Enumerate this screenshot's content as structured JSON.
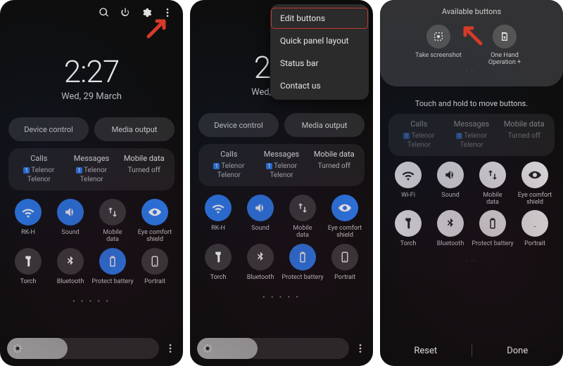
{
  "clock": {
    "time": "2:27",
    "date": "Wed, 29 March"
  },
  "top_icons": [
    "search-icon",
    "power-icon",
    "settings-icon",
    "overflow-icon"
  ],
  "pills": {
    "device_control": "Device control",
    "media_output": "Media output"
  },
  "info_panel": {
    "calls": {
      "title": "Calls",
      "line1_badge": "1",
      "line1": "Telenor",
      "line2": "Telenor"
    },
    "messages": {
      "title": "Messages",
      "line1_badge": "1",
      "line1": "Telenor",
      "line2": "Telenor"
    },
    "data": {
      "title": "Mobile data",
      "line1": "Turned off",
      "line2": ""
    }
  },
  "tiles": [
    {
      "name": "wifi",
      "label": "RK-H",
      "state": "on",
      "icon": "wifi-icon"
    },
    {
      "name": "sound",
      "label": "Sound",
      "state": "on",
      "icon": "sound-icon"
    },
    {
      "name": "mobile-data",
      "label": "Mobile\ndata",
      "state": "off",
      "icon": "arrows-icon"
    },
    {
      "name": "eye-comfort",
      "label": "Eye comfort\nshield",
      "state": "on",
      "icon": "eye-icon"
    },
    {
      "name": "torch",
      "label": "Torch",
      "state": "off",
      "icon": "torch-icon"
    },
    {
      "name": "bluetooth",
      "label": "Bluetooth",
      "state": "off",
      "icon": "bluetooth-icon"
    },
    {
      "name": "protect-battery",
      "label": "Protect battery",
      "state": "on",
      "icon": "battery-icon"
    },
    {
      "name": "portrait",
      "label": "Portrait",
      "state": "off",
      "icon": "portrait-icon"
    }
  ],
  "tiles_p3_overrides": {
    "wifi": {
      "label": "Wi-Fi",
      "state": "offw"
    },
    "sound": {
      "state": "offw"
    },
    "mobile-data": {
      "state": "offw"
    },
    "eye-comfort": {
      "state": "offw"
    },
    "torch": {
      "state": "offw"
    },
    "bluetooth": {
      "state": "offw"
    },
    "protect-battery": {
      "state": "offw"
    },
    "portrait": {
      "state": "offw"
    }
  },
  "menu": {
    "edit_buttons": "Edit buttons",
    "quick_panel_layout": "Quick panel layout",
    "status_bar": "Status bar",
    "contact_us": "Contact us"
  },
  "editor": {
    "available_title": "Available buttons",
    "hint": "Touch and hold to move buttons.",
    "buttons": [
      {
        "name": "take-screenshot",
        "label": "Take screenshot",
        "icon": "screenshot-icon"
      },
      {
        "name": "one-hand",
        "label": "One Hand\nOperation +",
        "icon": "onehand-icon"
      }
    ],
    "reset": "Reset",
    "done": "Done"
  },
  "colors": {
    "accent": "#2a7ef3",
    "arrow": "#d63a2a"
  }
}
